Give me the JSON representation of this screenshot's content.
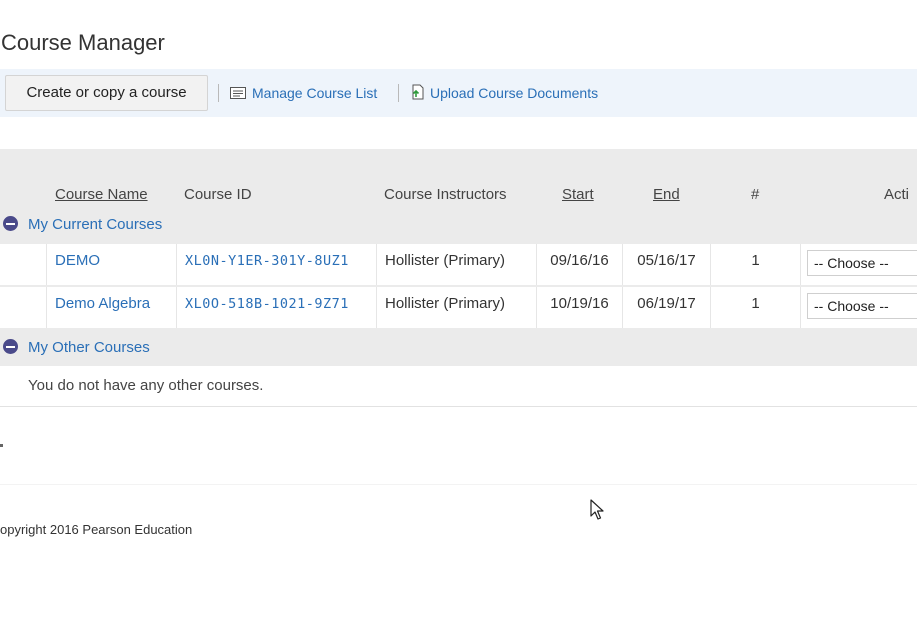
{
  "header": {
    "title": "Course Manager"
  },
  "toolbar": {
    "create_label": "Create or copy a course",
    "manage_label": "Manage Course List",
    "upload_label": "Upload Course Documents"
  },
  "table": {
    "columns": {
      "name": "Course Name",
      "id": "Course ID",
      "instructors": "Course Instructors",
      "start": "Start",
      "end": "End",
      "count": "#",
      "actions": "Acti"
    },
    "current_section": "My Current Courses",
    "current_rows": [
      {
        "name": "DEMO",
        "id": "XL0N-Y1ER-301Y-8UZ1",
        "instructor": "Hollister (Primary)",
        "start": "09/16/16",
        "end": "05/16/17",
        "count": "1",
        "action": "-- Choose --"
      },
      {
        "name": "Demo Algebra",
        "id": "XL0O-518B-1021-9Z71",
        "instructor": "Hollister (Primary)",
        "start": "10/19/16",
        "end": "06/19/17",
        "count": "1",
        "action": "-- Choose --"
      }
    ],
    "other_section": "My Other Courses",
    "other_empty": "You do not have any other courses."
  },
  "footer": {
    "copyright": "opyright 2016 Pearson Education"
  },
  "colors": {
    "link": "#2a6fb7",
    "toolbar_bg": "#eef4fb",
    "panel_bg": "#ebebeb"
  }
}
